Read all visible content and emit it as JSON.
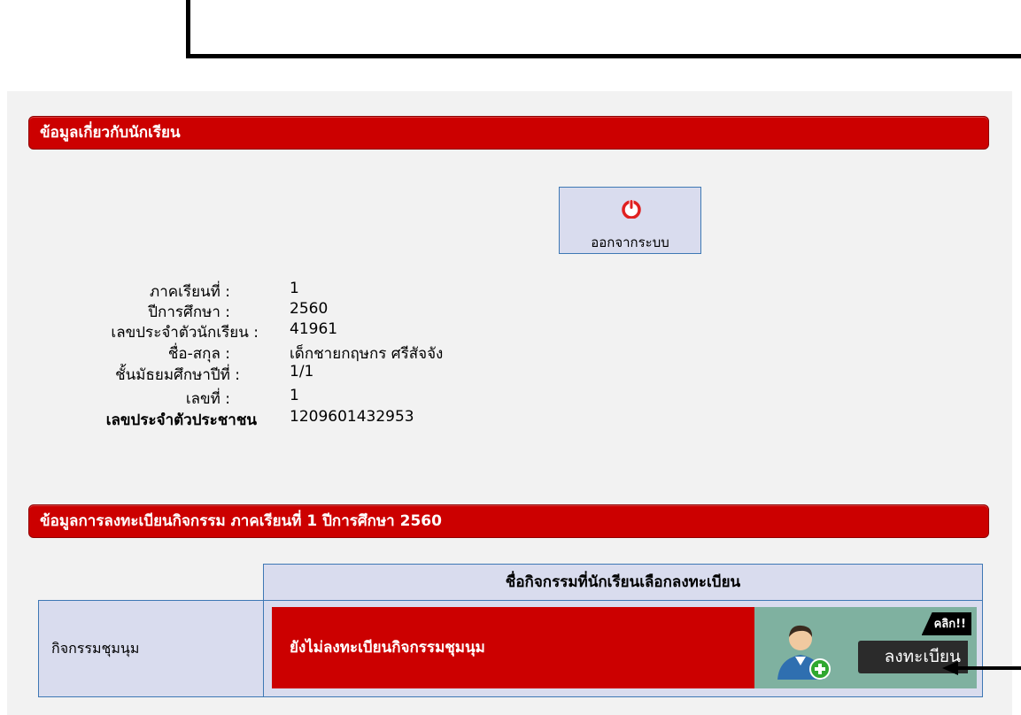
{
  "student_section": {
    "title": "ข้อมูลเกี่ยวกับนักเรียน",
    "logout_label": "ออกจากระบบ",
    "fields": [
      {
        "label": "ภาคเรียนที่ :",
        "value": "1"
      },
      {
        "label": "ปีการศึกษา :",
        "value": "2560"
      },
      {
        "label": "เลขประจำตัวนักเรียน :",
        "value": "41961"
      },
      {
        "label": "ชื่อ-สกุล :",
        "value": "เด็กชายกฤษกร ศรีสัจจัง"
      },
      {
        "label": "ชั้นมัธยมศึกษาปีที่ :",
        "value": "1/1"
      },
      {
        "label": "เลขที่ :",
        "value": "1"
      },
      {
        "label": "เลขประจำตัวประชาชน",
        "value": "1209601432953"
      }
    ]
  },
  "activity_section": {
    "title": "ข้อมูลการลงทะเบียนกิจกรรม ภาคเรียนที่ 1 ปีการศึกษา 2560",
    "column_header": "ชื่อกิจกรรมที่นักเรียนเลือกลงทะเบียน",
    "row": {
      "name": "กิจกรรมชุมนุม",
      "status": "ยังไม่ลงทะเบียนกิจกรรมชุมนุม",
      "click_badge": "คลิก!!",
      "register_label": "ลงทะเบียน"
    }
  },
  "colors": {
    "header_red": "#cc0000",
    "cell_blue": "#d9dcee",
    "border_blue": "#3e78b4",
    "register_green": "#7fb1a0"
  }
}
